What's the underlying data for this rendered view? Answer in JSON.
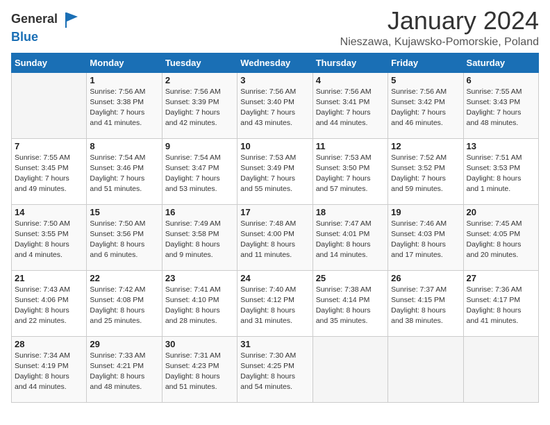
{
  "header": {
    "logo_general": "General",
    "logo_blue": "Blue",
    "month": "January 2024",
    "location": "Nieszawa, Kujawsko-Pomorskie, Poland"
  },
  "weekdays": [
    "Sunday",
    "Monday",
    "Tuesday",
    "Wednesday",
    "Thursday",
    "Friday",
    "Saturday"
  ],
  "weeks": [
    [
      {
        "num": "",
        "info": ""
      },
      {
        "num": "1",
        "info": "Sunrise: 7:56 AM\nSunset: 3:38 PM\nDaylight: 7 hours\nand 41 minutes."
      },
      {
        "num": "2",
        "info": "Sunrise: 7:56 AM\nSunset: 3:39 PM\nDaylight: 7 hours\nand 42 minutes."
      },
      {
        "num": "3",
        "info": "Sunrise: 7:56 AM\nSunset: 3:40 PM\nDaylight: 7 hours\nand 43 minutes."
      },
      {
        "num": "4",
        "info": "Sunrise: 7:56 AM\nSunset: 3:41 PM\nDaylight: 7 hours\nand 44 minutes."
      },
      {
        "num": "5",
        "info": "Sunrise: 7:56 AM\nSunset: 3:42 PM\nDaylight: 7 hours\nand 46 minutes."
      },
      {
        "num": "6",
        "info": "Sunrise: 7:55 AM\nSunset: 3:43 PM\nDaylight: 7 hours\nand 48 minutes."
      }
    ],
    [
      {
        "num": "7",
        "info": "Sunrise: 7:55 AM\nSunset: 3:45 PM\nDaylight: 7 hours\nand 49 minutes."
      },
      {
        "num": "8",
        "info": "Sunrise: 7:54 AM\nSunset: 3:46 PM\nDaylight: 7 hours\nand 51 minutes."
      },
      {
        "num": "9",
        "info": "Sunrise: 7:54 AM\nSunset: 3:47 PM\nDaylight: 7 hours\nand 53 minutes."
      },
      {
        "num": "10",
        "info": "Sunrise: 7:53 AM\nSunset: 3:49 PM\nDaylight: 7 hours\nand 55 minutes."
      },
      {
        "num": "11",
        "info": "Sunrise: 7:53 AM\nSunset: 3:50 PM\nDaylight: 7 hours\nand 57 minutes."
      },
      {
        "num": "12",
        "info": "Sunrise: 7:52 AM\nSunset: 3:52 PM\nDaylight: 7 hours\nand 59 minutes."
      },
      {
        "num": "13",
        "info": "Sunrise: 7:51 AM\nSunset: 3:53 PM\nDaylight: 8 hours\nand 1 minute."
      }
    ],
    [
      {
        "num": "14",
        "info": "Sunrise: 7:50 AM\nSunset: 3:55 PM\nDaylight: 8 hours\nand 4 minutes."
      },
      {
        "num": "15",
        "info": "Sunrise: 7:50 AM\nSunset: 3:56 PM\nDaylight: 8 hours\nand 6 minutes."
      },
      {
        "num": "16",
        "info": "Sunrise: 7:49 AM\nSunset: 3:58 PM\nDaylight: 8 hours\nand 9 minutes."
      },
      {
        "num": "17",
        "info": "Sunrise: 7:48 AM\nSunset: 4:00 PM\nDaylight: 8 hours\nand 11 minutes."
      },
      {
        "num": "18",
        "info": "Sunrise: 7:47 AM\nSunset: 4:01 PM\nDaylight: 8 hours\nand 14 minutes."
      },
      {
        "num": "19",
        "info": "Sunrise: 7:46 AM\nSunset: 4:03 PM\nDaylight: 8 hours\nand 17 minutes."
      },
      {
        "num": "20",
        "info": "Sunrise: 7:45 AM\nSunset: 4:05 PM\nDaylight: 8 hours\nand 20 minutes."
      }
    ],
    [
      {
        "num": "21",
        "info": "Sunrise: 7:43 AM\nSunset: 4:06 PM\nDaylight: 8 hours\nand 22 minutes."
      },
      {
        "num": "22",
        "info": "Sunrise: 7:42 AM\nSunset: 4:08 PM\nDaylight: 8 hours\nand 25 minutes."
      },
      {
        "num": "23",
        "info": "Sunrise: 7:41 AM\nSunset: 4:10 PM\nDaylight: 8 hours\nand 28 minutes."
      },
      {
        "num": "24",
        "info": "Sunrise: 7:40 AM\nSunset: 4:12 PM\nDaylight: 8 hours\nand 31 minutes."
      },
      {
        "num": "25",
        "info": "Sunrise: 7:38 AM\nSunset: 4:14 PM\nDaylight: 8 hours\nand 35 minutes."
      },
      {
        "num": "26",
        "info": "Sunrise: 7:37 AM\nSunset: 4:15 PM\nDaylight: 8 hours\nand 38 minutes."
      },
      {
        "num": "27",
        "info": "Sunrise: 7:36 AM\nSunset: 4:17 PM\nDaylight: 8 hours\nand 41 minutes."
      }
    ],
    [
      {
        "num": "28",
        "info": "Sunrise: 7:34 AM\nSunset: 4:19 PM\nDaylight: 8 hours\nand 44 minutes."
      },
      {
        "num": "29",
        "info": "Sunrise: 7:33 AM\nSunset: 4:21 PM\nDaylight: 8 hours\nand 48 minutes."
      },
      {
        "num": "30",
        "info": "Sunrise: 7:31 AM\nSunset: 4:23 PM\nDaylight: 8 hours\nand 51 minutes."
      },
      {
        "num": "31",
        "info": "Sunrise: 7:30 AM\nSunset: 4:25 PM\nDaylight: 8 hours\nand 54 minutes."
      },
      {
        "num": "",
        "info": ""
      },
      {
        "num": "",
        "info": ""
      },
      {
        "num": "",
        "info": ""
      }
    ]
  ]
}
